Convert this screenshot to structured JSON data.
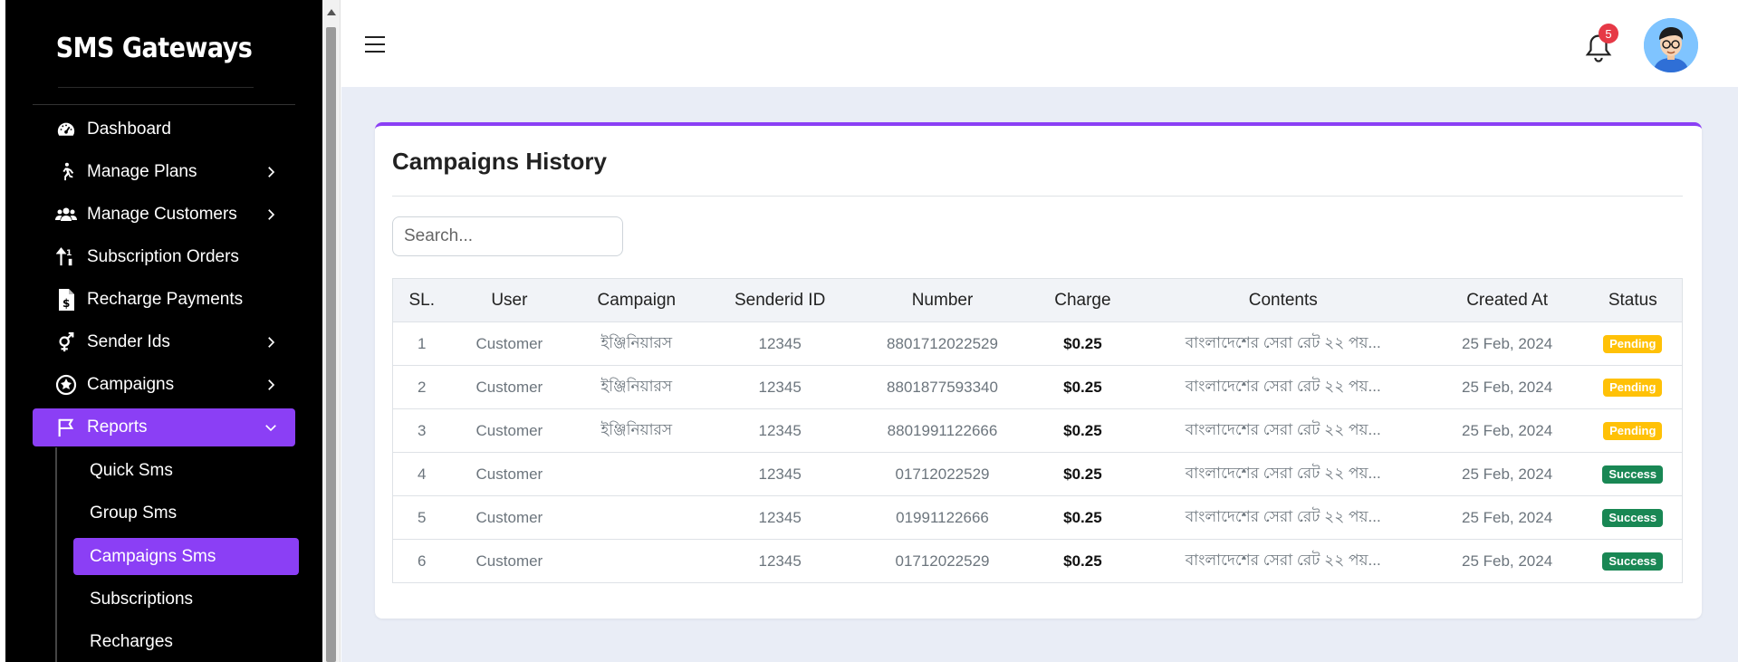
{
  "app": {
    "brand": "SMS Gateways"
  },
  "sidebar": {
    "items": [
      {
        "label": "Dashboard",
        "icon": "gauge-icon",
        "chevron": false
      },
      {
        "label": "Manage Plans",
        "icon": "walking-person-icon",
        "chevron": true
      },
      {
        "label": "Manage Customers",
        "icon": "users-icon",
        "chevron": true
      },
      {
        "label": "Subscription Orders",
        "icon": "sort-arrows-icon",
        "chevron": false
      },
      {
        "label": "Recharge Payments",
        "icon": "invoice-dollar-icon",
        "chevron": false
      },
      {
        "label": "Sender Ids",
        "icon": "gender-icon",
        "chevron": true
      },
      {
        "label": "Campaigns",
        "icon": "campaign-badge-icon",
        "chevron": true
      },
      {
        "label": "Reports",
        "icon": "flag-icon",
        "chevron": true,
        "active": true
      }
    ],
    "sub_items": [
      {
        "label": "Quick Sms"
      },
      {
        "label": "Group Sms"
      },
      {
        "label": "Campaigns Sms",
        "active": true
      },
      {
        "label": "Subscriptions"
      },
      {
        "label": "Recharges"
      }
    ]
  },
  "topbar": {
    "notification_count": "5"
  },
  "card": {
    "title": "Campaigns History",
    "search_placeholder": "Search..."
  },
  "table": {
    "headers": [
      "SL.",
      "User",
      "Campaign",
      "Senderid ID",
      "Number",
      "Charge",
      "Contents",
      "Created At",
      "Status"
    ],
    "rows": [
      {
        "sl": "1",
        "user": "Customer",
        "campaign": "ইঞ্জিনিয়ারস",
        "senderid": "12345",
        "number": "8801712022529",
        "charge": "$0.25",
        "contents": "বাংলাদেশের সেরা রেট ২২ পয়...",
        "created": "25 Feb, 2024",
        "status": "Pending"
      },
      {
        "sl": "2",
        "user": "Customer",
        "campaign": "ইঞ্জিনিয়ারস",
        "senderid": "12345",
        "number": "8801877593340",
        "charge": "$0.25",
        "contents": "বাংলাদেশের সেরা রেট ২২ পয়...",
        "created": "25 Feb, 2024",
        "status": "Pending"
      },
      {
        "sl": "3",
        "user": "Customer",
        "campaign": "ইঞ্জিনিয়ারস",
        "senderid": "12345",
        "number": "8801991122666",
        "charge": "$0.25",
        "contents": "বাংলাদেশের সেরা রেট ২২ পয়...",
        "created": "25 Feb, 2024",
        "status": "Pending"
      },
      {
        "sl": "4",
        "user": "Customer",
        "campaign": "",
        "senderid": "12345",
        "number": "01712022529",
        "charge": "$0.25",
        "contents": "বাংলাদেশের সেরা রেট ২২ পয়...",
        "created": "25 Feb, 2024",
        "status": "Success"
      },
      {
        "sl": "5",
        "user": "Customer",
        "campaign": "",
        "senderid": "12345",
        "number": "01991122666",
        "charge": "$0.25",
        "contents": "বাংলাদেশের সেরা রেট ২২ পয়...",
        "created": "25 Feb, 2024",
        "status": "Success"
      },
      {
        "sl": "6",
        "user": "Customer",
        "campaign": "",
        "senderid": "12345",
        "number": "01712022529",
        "charge": "$0.25",
        "contents": "বাংলাদেশের সেরা রেট ২২ পয়...",
        "created": "25 Feb, 2024",
        "status": "Success"
      }
    ]
  },
  "colors": {
    "accent": "#8b3ff5",
    "sidebar_bg": "#000000",
    "main_bg": "#e9edf6",
    "pending": "#ffc107",
    "success": "#198754",
    "badge": "#e63946"
  }
}
